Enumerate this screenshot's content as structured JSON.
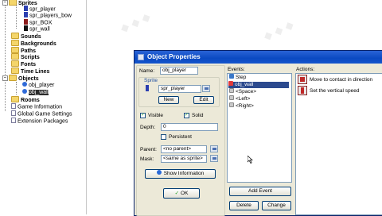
{
  "tree": {
    "items": [
      {
        "label": "Sprites",
        "kind": "folder",
        "bold": true
      },
      {
        "label": "spr_player",
        "kind": "sprite",
        "color": "#2b3fb0"
      },
      {
        "label": "spr_players_bow",
        "kind": "sprite",
        "color": "#2b3fb0"
      },
      {
        "label": "spr_BOX",
        "kind": "sprite",
        "color": "#8a1a1a"
      },
      {
        "label": "spr_wall",
        "kind": "sprite",
        "color": "#111111"
      },
      {
        "label": "Sounds",
        "kind": "folder",
        "bold": true
      },
      {
        "label": "Backgrounds",
        "kind": "folder",
        "bold": true
      },
      {
        "label": "Paths",
        "kind": "folder",
        "bold": true
      },
      {
        "label": "Scripts",
        "kind": "folder",
        "bold": true
      },
      {
        "label": "Fonts",
        "kind": "folder",
        "bold": true
      },
      {
        "label": "Time Lines",
        "kind": "folder",
        "bold": true
      },
      {
        "label": "Objects",
        "kind": "folder",
        "bold": true
      },
      {
        "label": "obj_player",
        "kind": "object"
      },
      {
        "label": "obj_wall",
        "kind": "object",
        "selected": true
      },
      {
        "label": "Rooms",
        "kind": "folder",
        "bold": true
      },
      {
        "label": "Game Information",
        "kind": "doc"
      },
      {
        "label": "Global Game Settings",
        "kind": "doc"
      },
      {
        "label": "Extension Packages",
        "kind": "doc"
      }
    ]
  },
  "dialog": {
    "title": "Object Properties",
    "name_label": "Name:",
    "name_value": "obj_player",
    "sprite_group_label": "Sprite",
    "sprite_value": "spr_player",
    "new_button": "New",
    "edit_button": "Edit",
    "visible_label": "Visible",
    "visible_checked": "✓",
    "solid_label": "Solid",
    "solid_checked": "✓",
    "depth_label": "Depth:",
    "depth_value": "0",
    "persistent_label": "Persistent",
    "parent_label": "Parent:",
    "parent_value": "<no parent>",
    "mask_label": "Mask:",
    "mask_value": "<same as sprite>",
    "show_info_button": "Show Information",
    "ok_button": "OK",
    "ok_check": "✓",
    "events_label": "Events:",
    "events": [
      "Step",
      "obj_wall",
      "<Space>",
      "<Left>",
      "<Right>"
    ],
    "add_event_button": "Add Event",
    "delete_button": "Delete",
    "change_button": "Change",
    "actions_label": "Actions:",
    "actions": [
      "Move to contact in direction",
      "Set the vertical speed"
    ]
  },
  "colors": {
    "titlebar": "#0a49c2",
    "dialog_bg": "#ece9d8",
    "selection": "#2b2b2b"
  }
}
